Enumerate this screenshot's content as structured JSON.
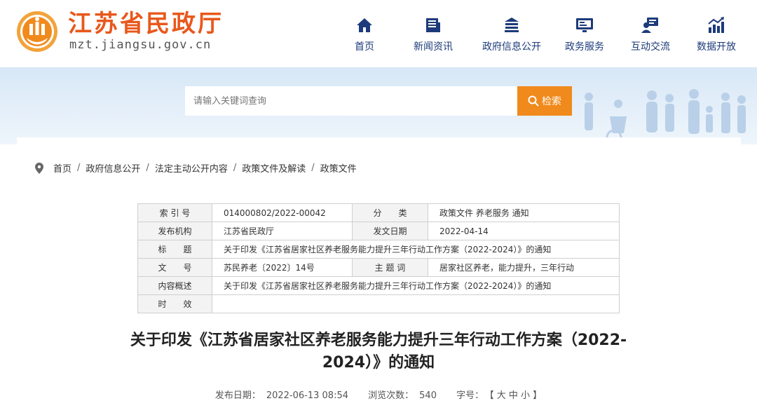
{
  "site": {
    "name": "江苏省民政厅",
    "url": "mzt.jiangsu.gov.cn"
  },
  "nav": [
    {
      "label": "首页",
      "icon": "home-icon"
    },
    {
      "label": "新闻资讯",
      "icon": "news-icon"
    },
    {
      "label": "政府信息公开",
      "icon": "building-icon"
    },
    {
      "label": "政务服务",
      "icon": "monitor-icon"
    },
    {
      "label": "互动交流",
      "icon": "chat-icon"
    },
    {
      "label": "数据开放",
      "icon": "bar-chart-icon"
    }
  ],
  "search": {
    "placeholder": "请输入关键词查询",
    "button_label": "检索"
  },
  "breadcrumb": [
    "首页",
    "政府信息公开",
    "法定主动公开内容",
    "政策文件及解读",
    "政策文件"
  ],
  "meta": {
    "index_label": "索 引 号",
    "index_value": "014000802/2022-00042",
    "category_label": "分　　类",
    "category_value": "政策文件 养老服务 通知",
    "issuer_label": "发布机构",
    "issuer_value": "江苏省民政厅",
    "date_label": "发文日期",
    "date_value": "2022-04-14",
    "title_label": "标　　题",
    "title_value": "关于印发《江苏省居家社区养老服务能力提升三年行动工作方案（2022-2024）》的通知",
    "docno_label": "文　　号",
    "docno_value": "苏民养老〔2022〕14号",
    "keywords_label": "主 题 词",
    "keywords_value": "居家社区养老，能力提升，三年行动",
    "summary_label": "内容概述",
    "summary_value": "关于印发《江苏省居家社区养老服务能力提升三年行动工作方案（2022-2024）》的通知",
    "validity_label": "时　　效",
    "validity_value": ""
  },
  "article": {
    "title_line1": "关于印发《江苏省居家社区养老服务能力提升三年行动工作方案（2022-",
    "title_line2": "2024）》的通知",
    "pub_date_label": "发布日期：",
    "pub_date": "2022-06-13 08:54",
    "views_label": "浏览次数：",
    "views": "540",
    "font_label": "字号：",
    "font_sizes": "【 大 中 小 】"
  },
  "colors": {
    "brand": "#e8581c",
    "nav_text": "#1d3b7a",
    "search_button": "#f08a1c"
  }
}
